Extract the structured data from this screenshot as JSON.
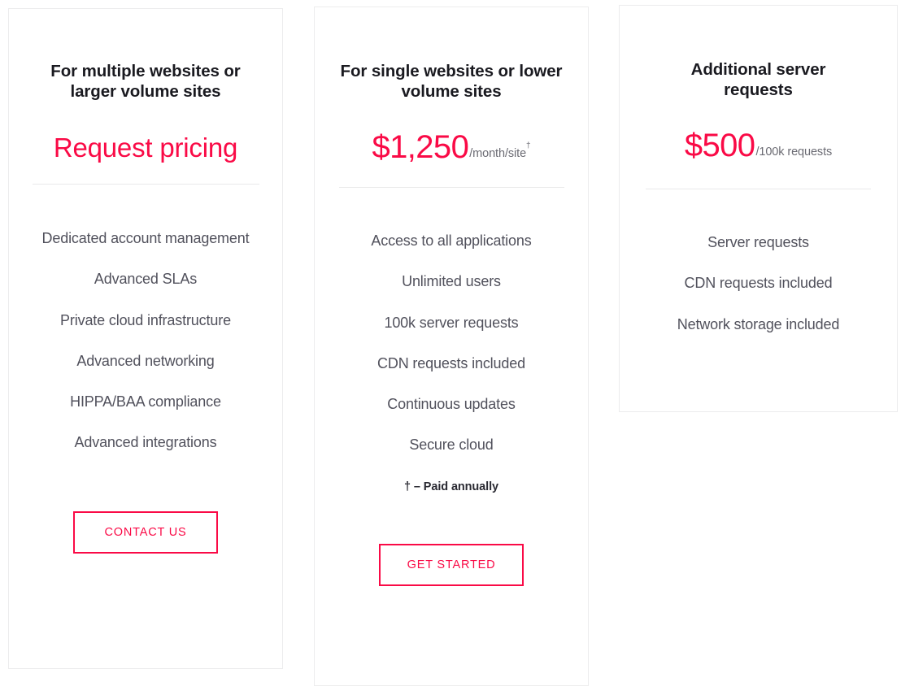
{
  "theme": {
    "accent": "#fa0a46",
    "heading_color": "#1a1a20",
    "feature_color": "#51515c",
    "card_border": "#ececed",
    "divider": "#e9e9ea",
    "background": "#ffffff"
  },
  "cards": [
    {
      "heading": "For multiple websites or larger volume sites",
      "price_quote": "Request pricing",
      "price_main": "",
      "price_suffix": "",
      "price_suffix_marker": "",
      "features": [
        "Dedicated account management",
        "Advanced SLAs",
        "Private cloud infrastructure",
        "Advanced networking",
        "HIPPA/BAA compliance",
        "Advanced integrations"
      ],
      "footnote": "",
      "cta_label": "CONTACT US"
    },
    {
      "heading": "For single websites or lower volume sites",
      "price_quote": "",
      "price_main": "$1,250",
      "price_suffix": "/month/site",
      "price_suffix_marker": "†",
      "features": [
        "Access to all applications",
        "Unlimited users",
        "100k server requests",
        "CDN requests included",
        "Continuous updates",
        "Secure cloud"
      ],
      "footnote": "† – Paid annually",
      "cta_label": "GET STARTED"
    },
    {
      "heading": "Additional server requests",
      "price_quote": "",
      "price_main": "$500",
      "price_suffix": "/100k requests",
      "price_suffix_marker": "",
      "features": [
        "Server requests",
        "CDN requests included",
        "Network storage included"
      ],
      "footnote": "",
      "cta_label": ""
    }
  ]
}
